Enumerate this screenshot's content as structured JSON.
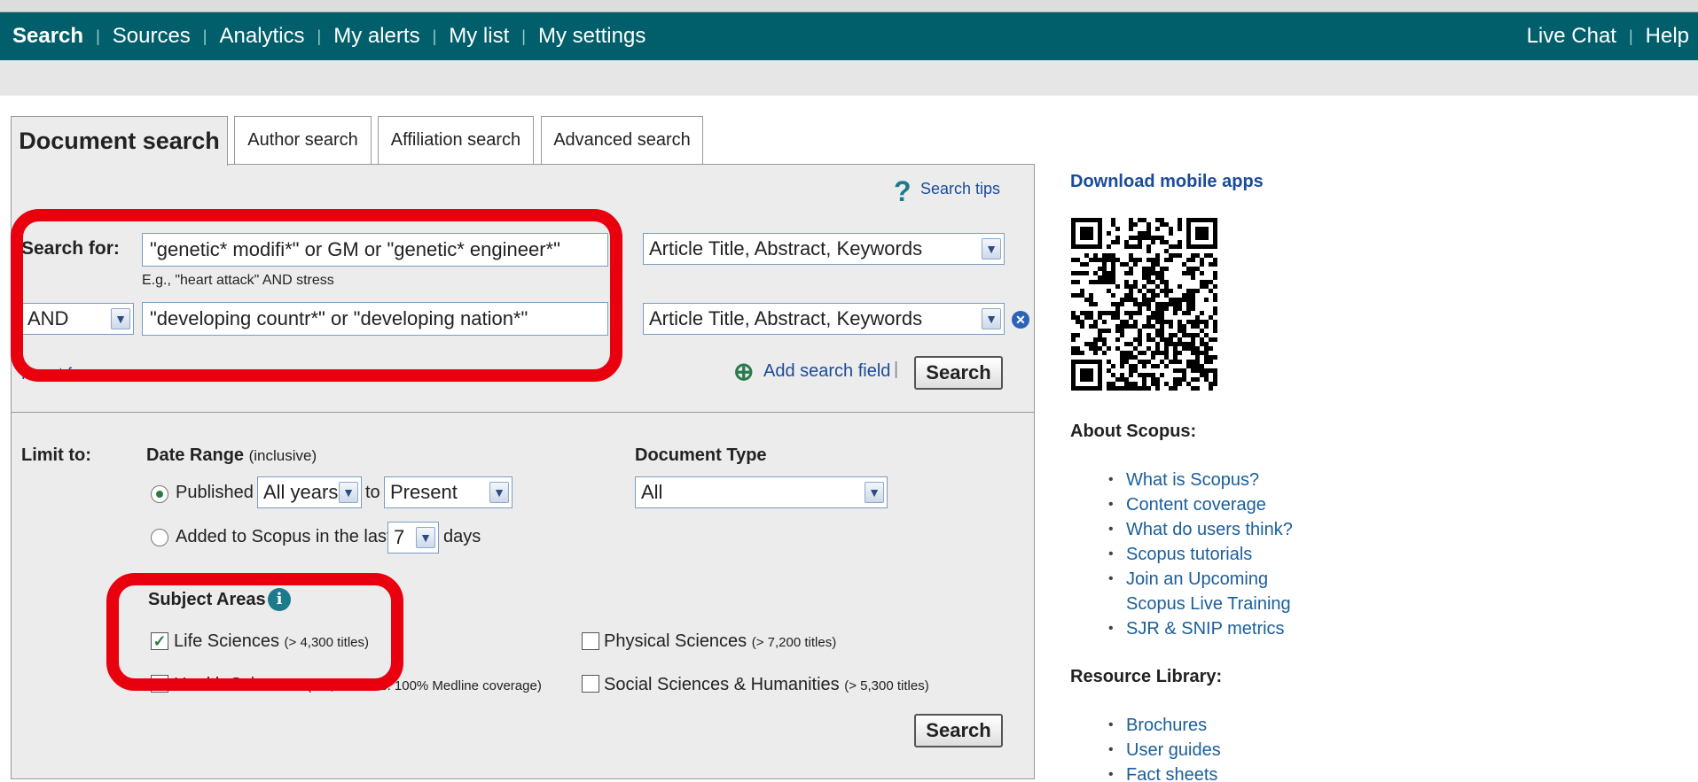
{
  "nav": {
    "items": [
      "Search",
      "Sources",
      "Analytics",
      "My alerts",
      "My list",
      "My settings"
    ],
    "right": [
      "Live Chat",
      "Help"
    ]
  },
  "tabs": {
    "document": "Document search",
    "author": "Author search",
    "affiliation": "Affiliation search",
    "advanced": "Advanced search"
  },
  "search": {
    "tips": "Search tips",
    "search_for_label": "Search for:",
    "query1": "\"genetic* modifi*\" or GM or \"genetic* engineer*\"",
    "example": "E.g., \"heart attack\" AND stress",
    "field1": "Article Title, Abstract, Keywords",
    "operator": "AND",
    "query2": "\"developing countr*\" or \"developing nation*\"",
    "field2": "Article Title, Abstract, Keywords",
    "reset": "Reset form",
    "add_field": "Add search field",
    "search_btn": "Search"
  },
  "limits": {
    "limit_to": "Limit to:",
    "date_range": "Date Range",
    "inclusive": "(inclusive)",
    "published": "Published",
    "from": "All years",
    "to_word": "to",
    "to": "Present",
    "added": "Added to Scopus in the last",
    "days_value": "7",
    "days": "days",
    "doc_type_title": "Document Type",
    "doc_type": "All"
  },
  "subjects": {
    "title": "Subject Areas",
    "life": "Life Sciences",
    "life_count": "(> 4,300 titles)",
    "physical": "Physical Sciences",
    "physical_count": "(> 7,200 titles)",
    "health": "Health Sciences",
    "health_count": "(> 6,800 titles. 100% Medline coverage)",
    "social": "Social Sciences & Humanities",
    "social_count": "(> 5,300 titles)",
    "search_btn": "Search"
  },
  "sidebar": {
    "mobile": "Download mobile apps",
    "about_title": "About Scopus:",
    "about": [
      "What is Scopus?",
      "Content coverage",
      "What do users think?",
      "Scopus tutorials",
      "Join an Upcoming Scopus Live Training",
      "SJR & SNIP metrics"
    ],
    "resource_title": "Resource Library:",
    "resources": [
      "Brochures",
      "User guides",
      "Fact sheets"
    ]
  }
}
